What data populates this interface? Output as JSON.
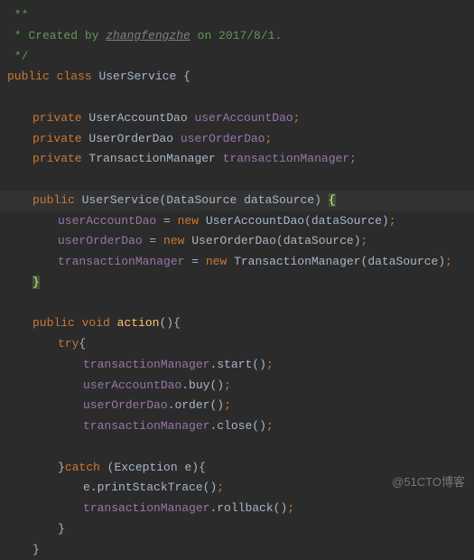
{
  "comment": {
    "open": " **",
    "created_prefix": " * Created by ",
    "author": "zhangfengzhe",
    "created_suffix": " on 2017/8/1.",
    "close": " */"
  },
  "kw": {
    "public": "public",
    "class": "class",
    "private": "private",
    "void": "void",
    "new": "new",
    "try": "try",
    "catch": "catch"
  },
  "cls": {
    "UserService": "UserService",
    "UserAccountDao": "UserAccountDao",
    "UserOrderDao": "UserOrderDao",
    "TransactionManager": "TransactionManager",
    "DataSource": "DataSource",
    "Exception": "Exception"
  },
  "field": {
    "userAccountDao": "userAccountDao",
    "userOrderDao": "userOrderDao",
    "transactionManager": "transactionManager"
  },
  "var": {
    "dataSource": "dataSource",
    "e": "e"
  },
  "method": {
    "action": "action",
    "start": "start",
    "buy": "buy",
    "order": "order",
    "close": "close",
    "printStackTrace": "printStackTrace",
    "rollback": "rollback"
  },
  "sym": {
    "lbrace": "{",
    "rbrace": "}",
    "lparen": "(",
    "rparen": ")",
    "semi": ";",
    "eq": " = ",
    "sp": " ",
    "dot": "."
  },
  "watermark": "@51CTO博客"
}
